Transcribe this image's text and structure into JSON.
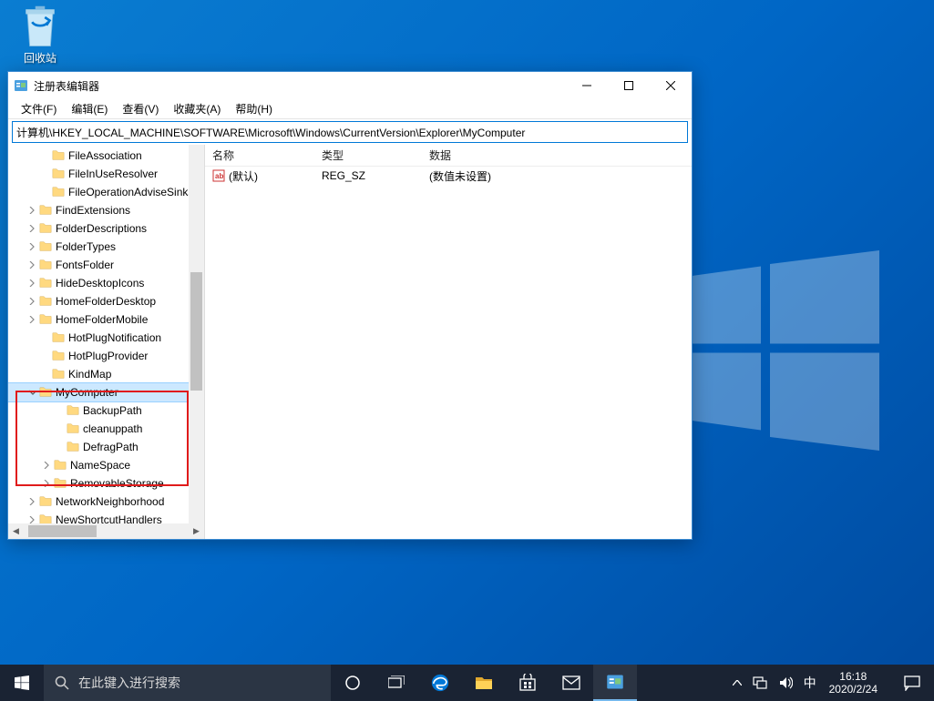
{
  "desktop": {
    "recycle_bin": "回收站"
  },
  "window": {
    "title": "注册表编辑器",
    "menu": {
      "file": "文件(F)",
      "edit": "编辑(E)",
      "view": "查看(V)",
      "favorites": "收藏夹(A)",
      "help": "帮助(H)"
    },
    "address": "计算机\\HKEY_LOCAL_MACHINE\\SOFTWARE\\Microsoft\\Windows\\CurrentVersion\\Explorer\\MyComputer",
    "tree": [
      {
        "label": "FileAssociation",
        "indent": 34,
        "exp": "none"
      },
      {
        "label": "FileInUseResolver",
        "indent": 34,
        "exp": "none"
      },
      {
        "label": "FileOperationAdviseSinks",
        "indent": 34,
        "exp": "none"
      },
      {
        "label": "FindExtensions",
        "indent": 20,
        "exp": "closed"
      },
      {
        "label": "FolderDescriptions",
        "indent": 20,
        "exp": "closed"
      },
      {
        "label": "FolderTypes",
        "indent": 20,
        "exp": "closed"
      },
      {
        "label": "FontsFolder",
        "indent": 20,
        "exp": "closed"
      },
      {
        "label": "HideDesktopIcons",
        "indent": 20,
        "exp": "closed"
      },
      {
        "label": "HomeFolderDesktop",
        "indent": 20,
        "exp": "closed"
      },
      {
        "label": "HomeFolderMobile",
        "indent": 20,
        "exp": "closed"
      },
      {
        "label": "HotPlugNotification",
        "indent": 34,
        "exp": "none"
      },
      {
        "label": "HotPlugProvider",
        "indent": 34,
        "exp": "none"
      },
      {
        "label": "KindMap",
        "indent": 34,
        "exp": "none"
      },
      {
        "label": "MyComputer",
        "indent": 20,
        "exp": "open",
        "selected": true
      },
      {
        "label": "BackupPath",
        "indent": 50,
        "exp": "none"
      },
      {
        "label": "cleanuppath",
        "indent": 50,
        "exp": "none"
      },
      {
        "label": "DefragPath",
        "indent": 50,
        "exp": "none"
      },
      {
        "label": "NameSpace",
        "indent": 36,
        "exp": "closed"
      },
      {
        "label": "RemovableStorage",
        "indent": 36,
        "exp": "closed"
      },
      {
        "label": "NetworkNeighborhood",
        "indent": 20,
        "exp": "closed"
      },
      {
        "label": "NewShortcutHandlers",
        "indent": 20,
        "exp": "closed"
      }
    ],
    "list": {
      "headers": {
        "name": "名称",
        "type": "类型",
        "data": "数据"
      },
      "rows": [
        {
          "name": "(默认)",
          "type": "REG_SZ",
          "data": "(数值未设置)"
        }
      ]
    }
  },
  "taskbar": {
    "search_placeholder": "在此键入进行搜索",
    "ime": "中",
    "time": "16:18",
    "date": "2020/2/24"
  }
}
